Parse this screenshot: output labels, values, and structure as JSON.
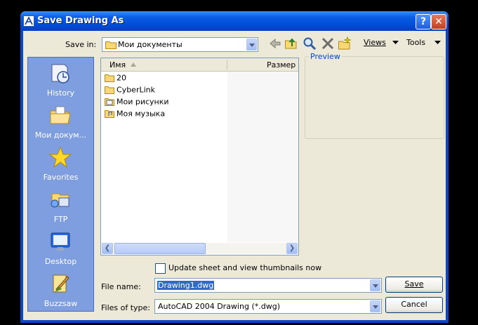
{
  "window": {
    "title": "Save Drawing As",
    "help_glyph": "?",
    "close_glyph": "✕"
  },
  "toolbar": {
    "save_in_label": "Save in:",
    "save_in_value": "Мои документы",
    "views_label": "Views",
    "tools_label": "Tools",
    "icons": [
      "back-icon",
      "up-folder-icon",
      "search-web-icon",
      "delete-icon",
      "new-folder-icon"
    ]
  },
  "places": [
    {
      "label": "History",
      "icon": "history-icon"
    },
    {
      "label": "Мои докум...",
      "icon": "my-documents-icon"
    },
    {
      "label": "Favorites",
      "icon": "favorites-star-icon"
    },
    {
      "label": "FTP",
      "icon": "ftp-icon"
    },
    {
      "label": "Desktop",
      "icon": "desktop-icon"
    },
    {
      "label": "Buzzsaw",
      "icon": "buzzsaw-icon"
    }
  ],
  "filelist": {
    "columns": [
      "Имя",
      "Размер"
    ],
    "items": [
      {
        "name": "20",
        "icon": "folder-icon"
      },
      {
        "name": "CyberLink",
        "icon": "folder-icon"
      },
      {
        "name": "Мои рисунки",
        "icon": "pictures-folder-icon"
      },
      {
        "name": "Моя музыка",
        "icon": "music-folder-icon"
      }
    ]
  },
  "preview": {
    "label": "Preview"
  },
  "options": {
    "thumbnails_label": "Update sheet and view thumbnails now",
    "thumbnails_checked": false
  },
  "form": {
    "file_name_label": "File name:",
    "file_name_value": "Drawing1.dwg",
    "file_type_label": "Files of type:",
    "file_type_value": "AutoCAD 2004 Drawing (*.dwg)"
  },
  "buttons": {
    "save": "Save",
    "cancel": "Cancel"
  },
  "colors": {
    "title_bar": "#0a5ee6",
    "places_bar": "#7f9ee0",
    "dialog_bg": "#ece9d8",
    "preview_label": "#0046d5"
  }
}
